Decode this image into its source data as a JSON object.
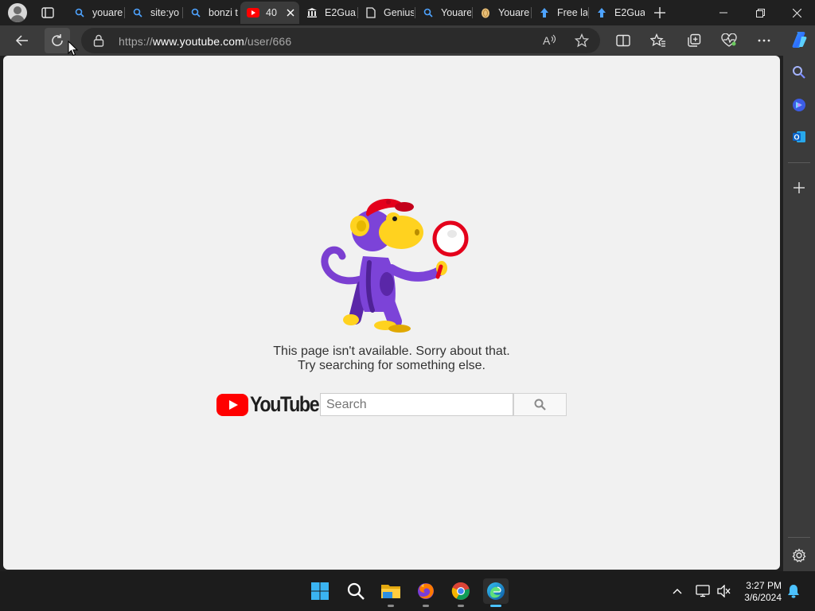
{
  "browser": {
    "tabs": [
      {
        "label": "youare",
        "favicon": "search-icon"
      },
      {
        "label": "site:yo",
        "favicon": "search-icon"
      },
      {
        "label": "bonzi t",
        "favicon": "search-icon"
      },
      {
        "label": "40",
        "favicon": "youtube-icon",
        "active": true
      },
      {
        "label": "E2Gua",
        "favicon": "museum-icon"
      },
      {
        "label": "Genius",
        "favicon": "document-icon"
      },
      {
        "label": "Youare",
        "favicon": "search-icon"
      },
      {
        "label": "Youare",
        "favicon": "egg-icon"
      },
      {
        "label": "Free la",
        "favicon": "upload-arrow-icon"
      },
      {
        "label": "E2Gua",
        "favicon": "upload-arrow-icon"
      }
    ],
    "address": {
      "prefix": "https://",
      "domain": "www.youtube.com",
      "path": "/user/666"
    }
  },
  "page": {
    "error_line1": "This page isn't available. Sorry about that.",
    "error_line2": "Try searching for something else.",
    "logo_text": "YouTube",
    "search_placeholder": "Search"
  },
  "taskbar": {
    "apps": [
      "start-icon",
      "search-icon",
      "file-explorer-icon",
      "firefox-icon",
      "chrome-icon",
      "edge-icon"
    ],
    "time": "3:27 PM",
    "date": "3/6/2024"
  },
  "colors": {
    "youtube_red": "#ff0000",
    "edge_accent": "#4cc2ff",
    "page_bg": "#f1f1f1"
  }
}
